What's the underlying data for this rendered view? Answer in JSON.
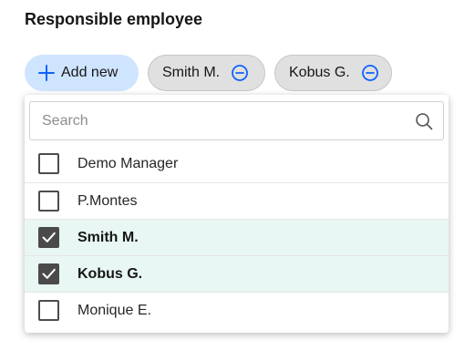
{
  "field": {
    "label": "Responsible employee"
  },
  "add_button": {
    "label": "Add new"
  },
  "selected_chips": [
    {
      "label": "Smith M."
    },
    {
      "label": "Kobus G."
    }
  ],
  "search": {
    "placeholder": "Search",
    "value": ""
  },
  "options": [
    {
      "label": "Demo Manager",
      "checked": false
    },
    {
      "label": "P.Montes",
      "checked": false
    },
    {
      "label": "Smith M.",
      "checked": true
    },
    {
      "label": "Kobus G.",
      "checked": true
    },
    {
      "label": "Monique E.",
      "checked": false
    }
  ],
  "colors": {
    "accent_blue": "#0f62fe",
    "add_button_bg": "#cfe4ff",
    "chip_bg": "#e0e0e0",
    "selected_row_bg": "#e8f7f3",
    "checkbox_checked": "#4a4a4a"
  },
  "icons": {
    "add": "plus-icon",
    "remove": "minus-circle-icon",
    "search": "search-icon",
    "check": "checkmark-icon"
  }
}
